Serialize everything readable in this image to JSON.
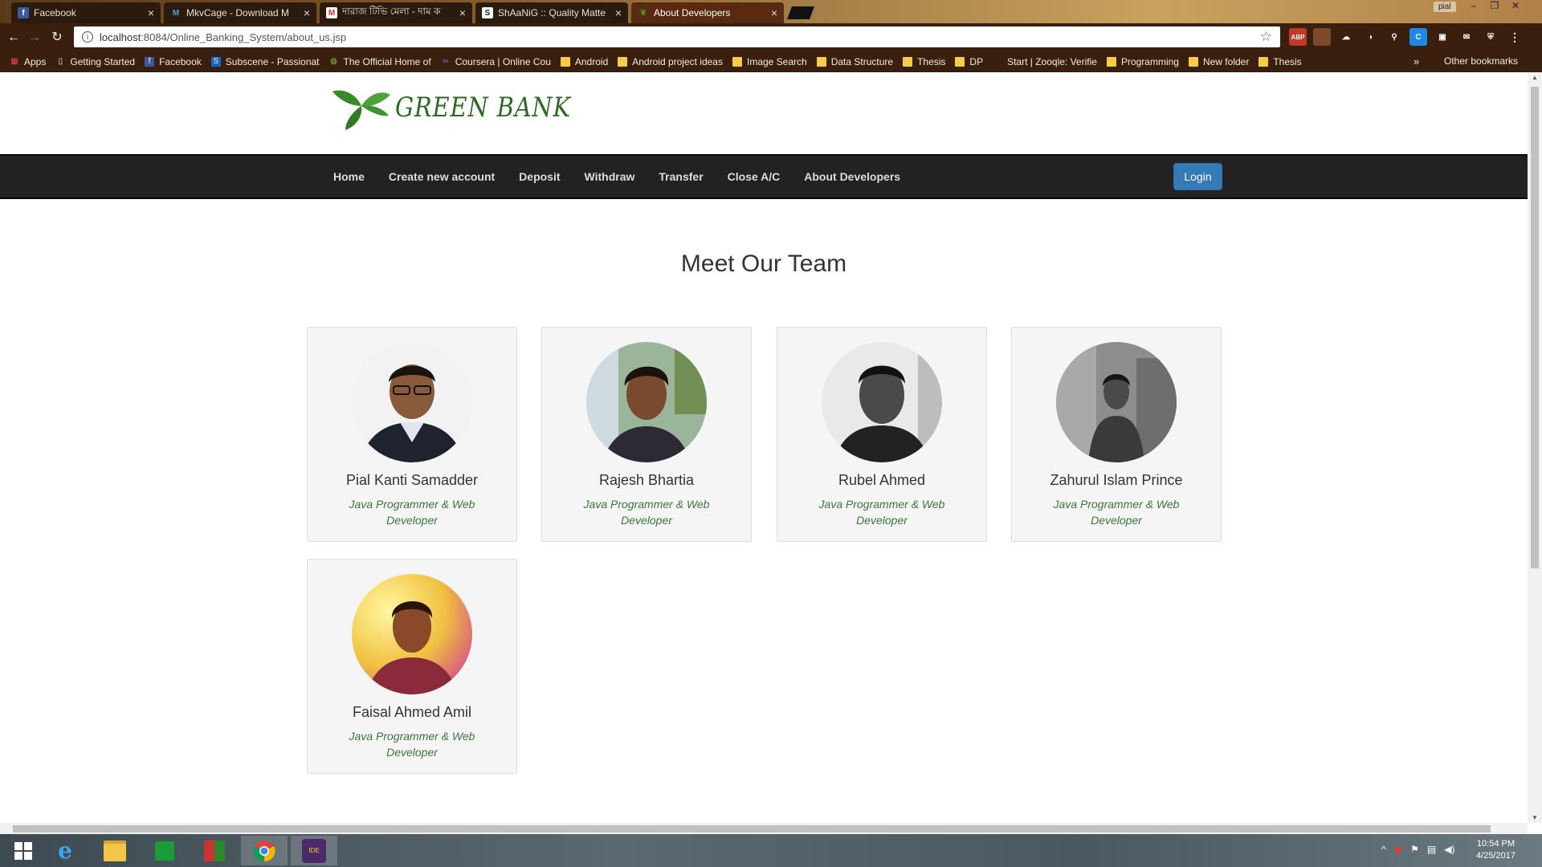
{
  "browser": {
    "tabs": [
      {
        "title": "Facebook",
        "icon": "facebook-icon"
      },
      {
        "title": "MkvCage - Download M",
        "icon": "mkvcage-icon"
      },
      {
        "title": "দারাজ টিভি মেলা - দাম ক",
        "icon": "gmail-icon"
      },
      {
        "title": "ShAaNiG :: Quality Matte",
        "icon": "shaanig-icon"
      },
      {
        "title": "About Developers",
        "icon": "leaf-icon"
      }
    ],
    "profile_name": "pial",
    "url_host": "localhost",
    "url_path": ":8084/Online_Banking_System/about_us.jsp",
    "extensions": [
      {
        "label": "ABP",
        "color": "#c0392b"
      },
      {
        "label": "",
        "color": "#7a4a2a"
      },
      {
        "label": "☁",
        "color": "#3b1f0e"
      },
      {
        "label": "◑",
        "color": "#3b1f0e"
      },
      {
        "label": "⚲",
        "color": "#3b1f0e"
      },
      {
        "label": "C",
        "color": "#1e88e5"
      },
      {
        "label": "▣",
        "color": "#3b1f0e"
      },
      {
        "label": "✉",
        "color": "#3b1f0e"
      },
      {
        "label": "⛨",
        "color": "#3b1f0e"
      }
    ],
    "bookmarks": [
      {
        "label": "Apps",
        "icon": "apps-icon"
      },
      {
        "label": "Getting Started",
        "icon": "page-icon"
      },
      {
        "label": "Facebook",
        "icon": "facebook-icon"
      },
      {
        "label": "Subscene - Passionat",
        "icon": "subscene-icon"
      },
      {
        "label": "The Official Home of",
        "icon": "site-icon"
      },
      {
        "label": "Coursera | Online Cou",
        "icon": "coursera-icon"
      },
      {
        "label": "Android",
        "icon": "folder-icon"
      },
      {
        "label": "Android project ideas",
        "icon": "folder-icon"
      },
      {
        "label": "Image Search",
        "icon": "folder-icon"
      },
      {
        "label": "Data Structure",
        "icon": "folder-icon"
      },
      {
        "label": "Thesis",
        "icon": "folder-icon"
      },
      {
        "label": "DP",
        "icon": "folder-icon"
      },
      {
        "label": "Start | Zooqle: Verifie",
        "icon": "zooqle-icon"
      },
      {
        "label": "Programming",
        "icon": "folder-icon"
      },
      {
        "label": "New folder",
        "icon": "folder-icon"
      },
      {
        "label": "Thesis",
        "icon": "folder-icon"
      }
    ],
    "other_bookmarks": "Other bookmarks"
  },
  "site": {
    "logo_text": "GREEN BANK",
    "nav": [
      "Home",
      "Create new account",
      "Deposit",
      "Withdraw",
      "Transfer",
      "Close A/C",
      "About Developers"
    ],
    "login_label": "Login"
  },
  "team": {
    "heading": "Meet Our Team",
    "members": [
      {
        "name": "Pial Kanti Samadder",
        "role": "Java Programmer & Web Developer"
      },
      {
        "name": "Rajesh Bhartia",
        "role": "Java Programmer & Web Developer"
      },
      {
        "name": "Rubel Ahmed",
        "role": "Java Programmer & Web Developer"
      },
      {
        "name": "Zahurul Islam Prince",
        "role": "Java Programmer & Web Developer"
      },
      {
        "name": "Faisal Ahmed Amil",
        "role": "Java Programmer & Web Developer"
      }
    ]
  },
  "taskbar": {
    "time": "10:54 PM",
    "date": "4/25/2017"
  }
}
